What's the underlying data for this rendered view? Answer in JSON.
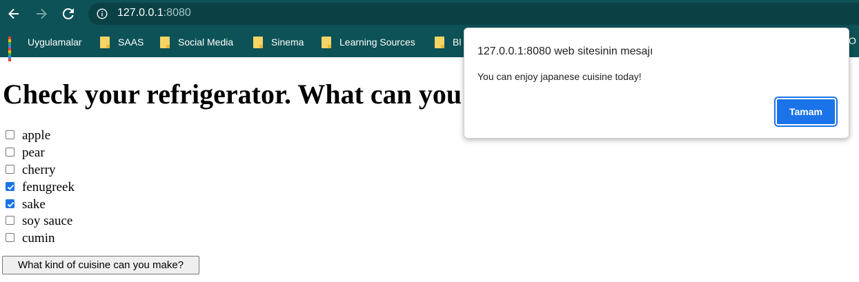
{
  "browser": {
    "url_host": "127.0.0.1",
    "url_port": ":8080",
    "bookmarks": [
      {
        "label": "Uygulamalar",
        "icon": "apps-grid-icon"
      },
      {
        "label": "SAAS",
        "icon": "folder-icon"
      },
      {
        "label": "Social Media",
        "icon": "folder-icon"
      },
      {
        "label": "Sinema",
        "icon": "folder-icon"
      },
      {
        "label": "Learning Sources",
        "icon": "folder-icon"
      },
      {
        "label": "Bl",
        "icon": "folder-icon"
      }
    ],
    "overflow_label": "O"
  },
  "page": {
    "title": "Check your refrigerator. What can you",
    "items": [
      {
        "label": "apple",
        "checked": false
      },
      {
        "label": "pear",
        "checked": false
      },
      {
        "label": "cherry",
        "checked": false
      },
      {
        "label": "fenugreek",
        "checked": true
      },
      {
        "label": "sake",
        "checked": true
      },
      {
        "label": "soy sauce",
        "checked": false
      },
      {
        "label": "cumin",
        "checked": false
      }
    ],
    "submit_label": "What kind of cuisine can you make?"
  },
  "dialog": {
    "title": "127.0.0.1:8080 web sitesinin mesajı",
    "message": "You can enjoy japanese cuisine today!",
    "ok_label": "Tamam"
  },
  "colors": {
    "chrome": "#0d5256",
    "accent": "#1a73e8"
  }
}
